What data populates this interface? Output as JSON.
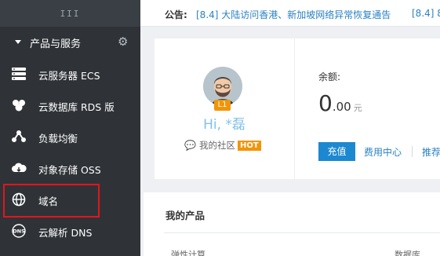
{
  "sidebar": {
    "toggle_icon": "III",
    "section_title": "产品与服务",
    "items": [
      {
        "label": "云服务器 ECS",
        "icon": "server-icon"
      },
      {
        "label": "云数据库 RDS 版",
        "icon": "database-icon"
      },
      {
        "label": "负载均衡",
        "icon": "load-balancer-icon"
      },
      {
        "label": "对象存储 OSS",
        "icon": "cloud-storage-icon"
      },
      {
        "label": "域名",
        "icon": "globe-icon"
      },
      {
        "label": "云解析 DNS",
        "icon": "dns-icon"
      }
    ],
    "highlight_color": "#e0161b"
  },
  "notice": {
    "label": "公告:",
    "items": [
      "[8.4] 大陆访问香港、新加坡网络异常恢复通告",
      "[8.4] 8"
    ]
  },
  "profile": {
    "level": "L1",
    "greeting": "Hi, *磊",
    "community_label": "我的社区",
    "hot_badge": "HOT"
  },
  "balance": {
    "label": "余额:",
    "amount_int": "0",
    "amount_dec": ".00",
    "unit": "元",
    "charge_button": "充值",
    "cost_center_link": "费用中心",
    "recommend_link": "推荐"
  },
  "products": {
    "title": "我的产品",
    "col_left": "弹性计算",
    "col_right": "数据库"
  },
  "colors": {
    "sidebar_bg": "#2f3338",
    "accent_blue": "#1c88d0",
    "badge_orange": "#f29408",
    "link_blue": "#2a82c4"
  }
}
